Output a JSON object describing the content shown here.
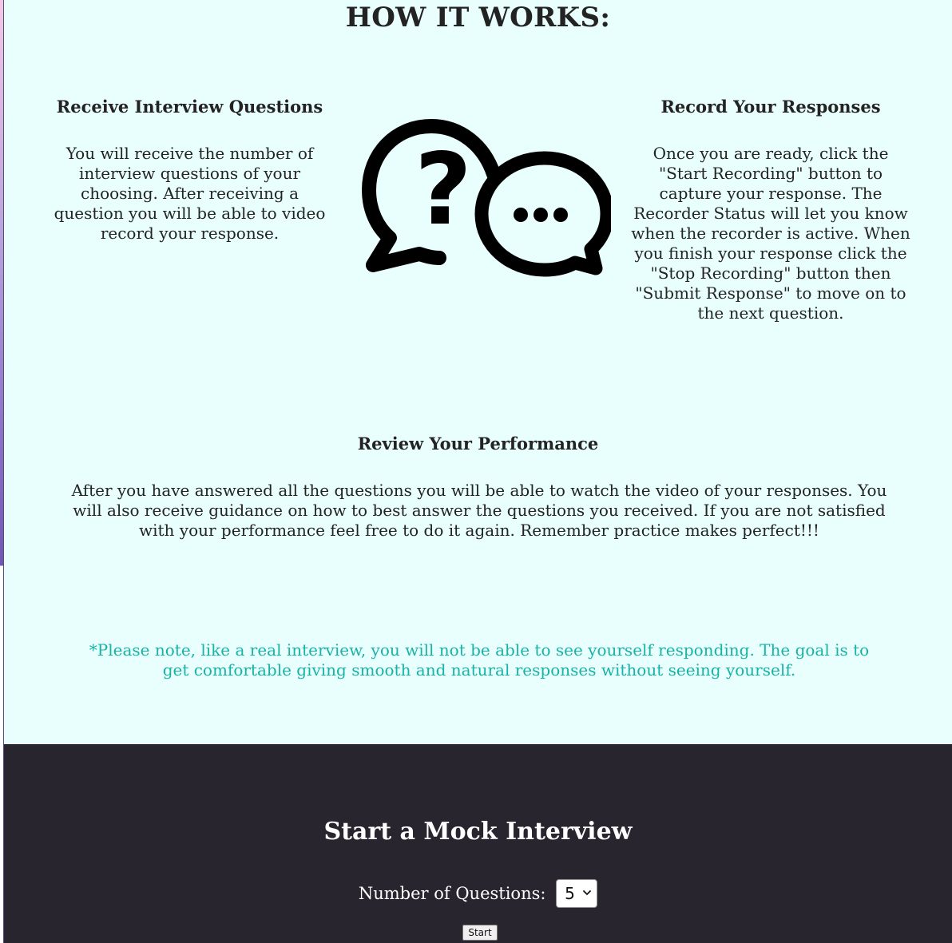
{
  "how_it_works": {
    "title": "HOW IT WORKS:",
    "steps": [
      {
        "title": "Receive Interview Questions",
        "text": "You will receive the number of interview questions of your choosing. After receiving a question you will be able to video record your response."
      },
      {
        "title": "Record Your Responses",
        "text": "Once you are ready, click the \"Start Recording\" button to capture your response. The Recorder Status will let you know when the recorder is active. When you finish your response click the \"Stop Recording\" button then \"Submit Response\" to move on to the next question."
      },
      {
        "title": "Review Your Performance",
        "text": "After you have answered all the questions you will be able to watch the video of your responses. You will also receive guidance on how to best answer the questions you received. If you are not satisfied with your performance feel free to do it again. Remember practice makes perfect!!!"
      }
    ],
    "note": "*Please note, like a real interview, you will not be able to see yourself responding. The goal is to get comfortable giving smooth and natural responses without seeing yourself.",
    "icon": "chat-bubbles-question-ellipsis-icon",
    "colors": {
      "background": "#e9fffd",
      "note": "#17b3a6",
      "text": "#232323"
    }
  },
  "start_interview": {
    "title": "Start a Mock Interview",
    "questions_label": "Number of Questions:",
    "questions_selected": "5",
    "start_button_label": "Start",
    "colors": {
      "background": "#28252f",
      "text": "#ffffff"
    }
  }
}
